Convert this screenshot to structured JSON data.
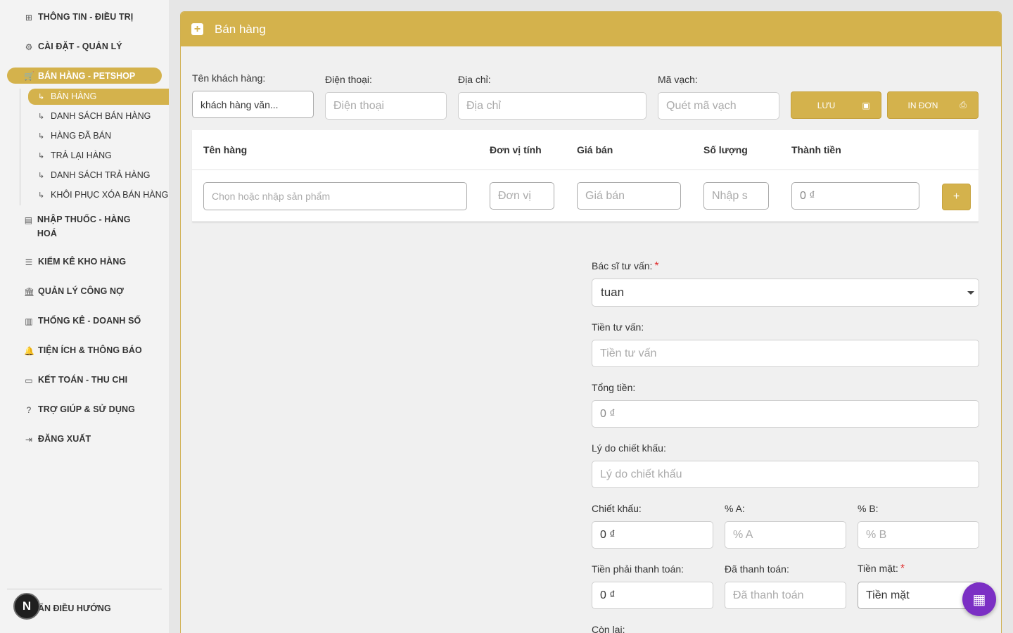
{
  "sidebar": {
    "items": [
      {
        "label": "THÔNG TIN - ĐIỀU TRỊ",
        "icon": "medical-cross-icon"
      },
      {
        "label": "CÀI ĐẶT - QUẢN LÝ",
        "icon": "gear-icon"
      },
      {
        "label": "BÁN HÀNG - PETSHOP",
        "icon": "cart-icon",
        "active": true
      },
      {
        "label": "NHẬP THUỐC - HÀNG HOÁ",
        "icon": "archive-icon"
      },
      {
        "label": "KIỂM KÊ KHO HÀNG",
        "icon": "list-icon"
      },
      {
        "label": "QUẢN LÝ CÔNG NỢ",
        "icon": "bank-icon"
      },
      {
        "label": "THỐNG KÊ - DOANH SỐ",
        "icon": "chart-icon"
      },
      {
        "label": "TIỆN ÍCH & THÔNG BÁO",
        "icon": "bell-icon"
      },
      {
        "label": "KẾT TOÁN - THU CHI",
        "icon": "card-icon"
      },
      {
        "label": "TRỢ GIÚP & SỬ DỤNG",
        "icon": "help-icon"
      },
      {
        "label": "ĐĂNG XUẤT",
        "icon": "logout-icon"
      }
    ],
    "subitems": [
      {
        "label": "BÁN HÀNG",
        "active": true
      },
      {
        "label": "DANH SÁCH BÁN HÀNG"
      },
      {
        "label": "HÀNG ĐÃ BÁN"
      },
      {
        "label": "TRẢ LẠI HÀNG"
      },
      {
        "label": "DANH SÁCH TRẢ HÀNG"
      },
      {
        "label": "KHÔI PHỤC XÓA BÁN HÀNG"
      }
    ],
    "collapse_label": "ẨN ĐIỀU HƯỚNG",
    "avatar_letter": "N"
  },
  "card": {
    "title": "Bán hàng"
  },
  "customer": {
    "name_label": "Tên khách hàng:",
    "name_value": "khách hàng văn...",
    "phone_label": "Điện thoại:",
    "phone_placeholder": "Điện thoại",
    "address_label": "Địa chỉ:",
    "address_placeholder": "Địa chỉ",
    "barcode_label": "Mã vạch:",
    "barcode_placeholder": "Quét mã vạch"
  },
  "actions": {
    "save_label": "LƯU",
    "print_label": "IN ĐƠN"
  },
  "table": {
    "headers": [
      "Tên hàng",
      "Đơn vị tính",
      "Giá bán",
      "Số lượng",
      "Thành tiền"
    ],
    "product_placeholder": "Chọn hoặc nhập sản phẩm",
    "unit_placeholder": "Đơn vị",
    "price_placeholder": "Giá bán",
    "qty_placeholder": "Nhập s",
    "total_value": "0 ₫"
  },
  "form": {
    "doctor_label": "Bác sĩ tư vấn:",
    "doctor_value": "tuan",
    "consult_fee_label": "Tiền tư vấn:",
    "consult_fee_placeholder": "Tiền tư vấn",
    "total_label": "Tổng tiền:",
    "total_value": "0 ₫",
    "discount_reason_label": "Lý do chiết khấu:",
    "discount_reason_placeholder": "Lý do chiết khấu",
    "discount_label": "Chiết khấu:",
    "discount_value": "0 ₫",
    "pct_a_label": "% A:",
    "pct_a_placeholder": "% A",
    "pct_b_label": "% B:",
    "pct_b_placeholder": "% B",
    "to_pay_label": "Tiền phải thanh toán:",
    "to_pay_value": "0 ₫",
    "paid_label": "Đã thanh toán:",
    "paid_placeholder": "Đã thanh toán",
    "cash_label": "Tiền mặt:",
    "cash_value": "Tiền mặt",
    "remaining_label": "Còn lại:",
    "required_mark": "*"
  },
  "colors": {
    "accent": "#d4b24c",
    "fab": "#7b2fc4",
    "required": "#e03131"
  }
}
